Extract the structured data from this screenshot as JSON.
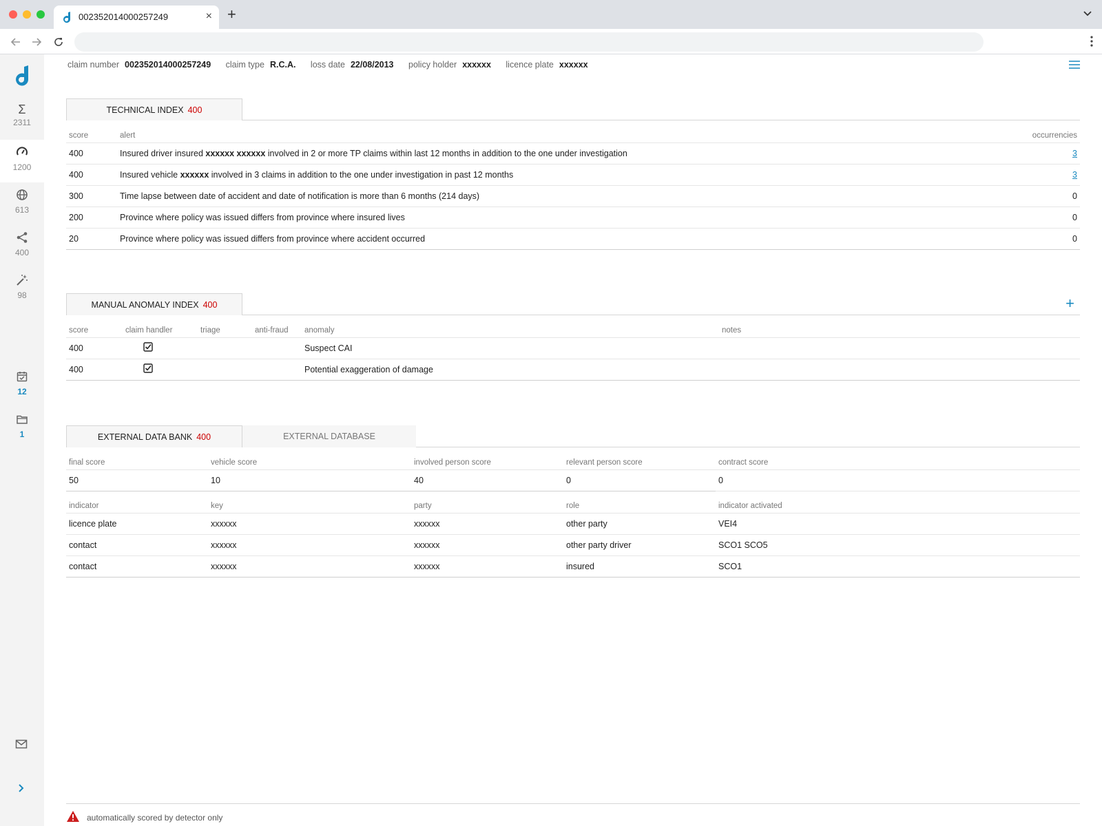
{
  "browser": {
    "tab_title": "002352014000257249",
    "new_tab_label": "+",
    "close_label": "×"
  },
  "sidebar": {
    "items": [
      {
        "icon": "sigma-icon",
        "count": "2311"
      },
      {
        "icon": "gauge-icon",
        "count": "1200",
        "active": true
      },
      {
        "icon": "globe-icon",
        "count": "613"
      },
      {
        "icon": "share-icon",
        "count": "400"
      },
      {
        "icon": "magic-wand-icon",
        "count": "98"
      },
      {
        "icon": "calendar-check-icon",
        "count": "12"
      },
      {
        "icon": "folder-icon",
        "count": "1"
      }
    ]
  },
  "header": {
    "claim_number_label": "claim number",
    "claim_number": "002352014000257249",
    "claim_type_label": "claim type",
    "claim_type": "R.C.A.",
    "loss_date_label": "loss date",
    "loss_date": "22/08/2013",
    "policy_holder_label": "policy holder",
    "policy_holder": "xxxxxx",
    "licence_plate_label": "licence plate",
    "licence_plate": "xxxxxx"
  },
  "technical": {
    "tab_label": "TECHNICAL INDEX",
    "score": "400",
    "columns": {
      "score": "score",
      "alert": "alert",
      "occurrencies": "occurrencies"
    },
    "rows": [
      {
        "score": "400",
        "alert_pre": "Insured driver insured ",
        "alert_bold": "xxxxxx xxxxxx",
        "alert_post": " involved in 2 or more TP claims within last 12 months in addition to the one under investigation",
        "occ": "3"
      },
      {
        "score": "400",
        "alert_pre": "Insured vehicle ",
        "alert_bold": "xxxxxx",
        "alert_post": " involved in 3 claims in addition to the one under investigation in past 12 months",
        "occ": "3"
      },
      {
        "score": "300",
        "alert": "Time lapse between date of accident and date of notification is more than 6 months (214 days)",
        "occ": "0"
      },
      {
        "score": "200",
        "alert": "Province where policy was issued differs from province where insured lives",
        "occ": "0"
      },
      {
        "score": "20",
        "alert": "Province where policy was issued differs from province where accident occurred",
        "occ": "0"
      }
    ]
  },
  "manual": {
    "tab_label": "MANUAL ANOMALY INDEX",
    "score": "400",
    "add_label": "+",
    "columns": {
      "score": "score",
      "claim_handler": "claim handler",
      "triage": "triage",
      "anti_fraud": "anti-fraud",
      "anomaly": "anomaly",
      "notes": "notes"
    },
    "rows": [
      {
        "score": "400",
        "anomaly": "Suspect CAI"
      },
      {
        "score": "400",
        "anomaly": "Potential exaggeration of damage"
      }
    ]
  },
  "external": {
    "tab_label": "EXTERNAL DATA BANK",
    "score": "400",
    "tab2_label": "EXTERNAL DATABASE",
    "score_columns": {
      "final": "final score",
      "vehicle": "vehicle score",
      "involved": "involved person score",
      "relevant": "relevant person score",
      "contract": "contract score"
    },
    "scores": {
      "final": "50",
      "vehicle": "10",
      "involved": "40",
      "relevant": "0",
      "contract": "0"
    },
    "indicator_columns": {
      "indicator": "indicator",
      "key": "key",
      "party": "party",
      "role": "role",
      "activated": "indicator activated"
    },
    "indicators": [
      {
        "indicator": "licence plate",
        "key": "xxxxxx",
        "party": "xxxxxx",
        "role": "other party",
        "activated": "VEI4"
      },
      {
        "indicator": "contact",
        "key": "xxxxxx",
        "party": "xxxxxx",
        "role": "other party driver",
        "activated": "SCO1 SCO5"
      },
      {
        "indicator": "contact",
        "key": "xxxxxx",
        "party": "xxxxxx",
        "role": "insured",
        "activated": "SCO1"
      }
    ]
  },
  "footer": {
    "text": "automatically scored by detector only"
  },
  "colors": {
    "accent": "#1a8ac0",
    "score_red": "#cc0000",
    "warning_red": "#cc1f1f"
  }
}
